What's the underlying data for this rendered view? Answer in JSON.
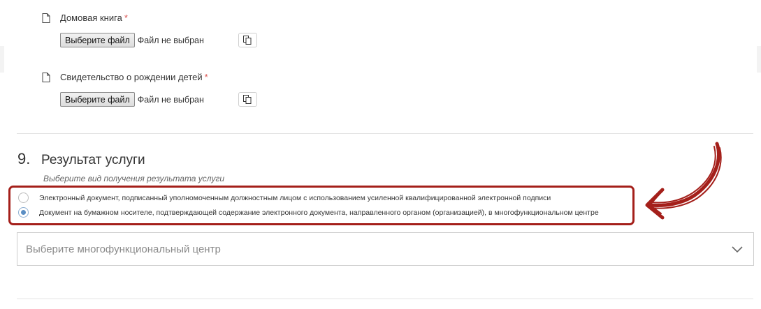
{
  "files": [
    {
      "label": "Домовая книга",
      "required_mark": "*",
      "button_label": "Выберите файл",
      "status": "Файл не выбран"
    },
    {
      "label": "Свидетельство о рождении детей",
      "required_mark": "*",
      "button_label": "Выберите файл",
      "status": "Файл не выбран"
    }
  ],
  "section": {
    "number": "9.",
    "title": "Результат услуги",
    "hint": "Выберите вид получения результата услуги",
    "options": [
      {
        "label": "Электронный документ, подписанный уполномоченным должностным лицом с использованием усиленной квалифицированной электронной подписи",
        "selected": false
      },
      {
        "label": "Документ на бумажном носителе, подтверждающей содержание электронного документа, направленного органом (организацией), в многофункциональном центре",
        "selected": true
      }
    ],
    "select_placeholder": "Выберите многофункциональный центр"
  },
  "colors": {
    "highlight": "#a41f1a",
    "radio_selected": "#5b8ec4",
    "required": "#d9534f"
  }
}
